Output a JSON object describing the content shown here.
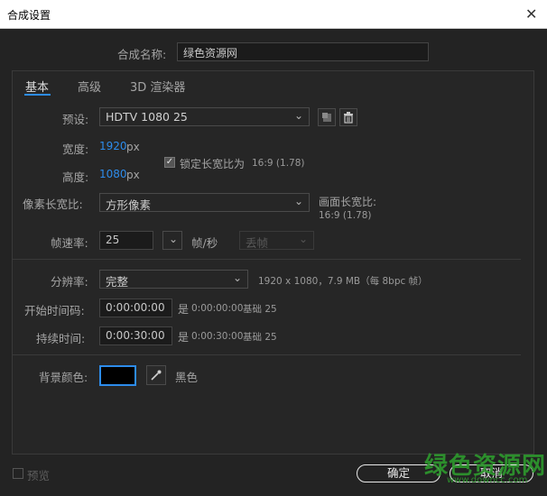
{
  "window": {
    "title": "合成设置",
    "close_glyph": "✕"
  },
  "comp_name": {
    "label": "合成名称:",
    "value": "绿色资源网"
  },
  "tabs": [
    {
      "label": "基本",
      "active": true
    },
    {
      "label": "高级",
      "active": false
    },
    {
      "label": "3D 渲染器",
      "active": false
    }
  ],
  "preset": {
    "label": "预设:",
    "value": "HDTV 1080 25",
    "chevron": "⌄"
  },
  "width": {
    "label": "宽度:",
    "value": "1920",
    "unit": "px"
  },
  "height": {
    "label": "高度:",
    "value": "1080",
    "unit": "px"
  },
  "lock_aspect": {
    "checked": true,
    "check_glyph": "✓",
    "label": "锁定长宽比为",
    "ratio": "16:9 (1.78)"
  },
  "pixel_aspect": {
    "label": "像素长宽比:",
    "value": "方形像素",
    "chevron": "⌄"
  },
  "frame_aspect": {
    "label": "画面长宽比:",
    "value": "16:9 (1.78)"
  },
  "frame_rate": {
    "label": "帧速率:",
    "value": "25",
    "chevron": "⌄",
    "unit": "帧/秒",
    "drop_frame": "丢帧"
  },
  "resolution": {
    "label": "分辨率:",
    "value": "完整",
    "chevron": "⌄",
    "info": "1920 x 1080，7.9 MB（每 8bpc 帧）"
  },
  "start_timecode": {
    "label": "开始时间码:",
    "value": "0:00:00:00",
    "is_label": "是",
    "is_value": "0:00:00:00",
    "base": "基础 25"
  },
  "duration": {
    "label": "持续时间:",
    "value": "0:00:30:00",
    "is_label": "是",
    "is_value": "0:00:30:00",
    "base": "基础 25"
  },
  "background": {
    "label": "背景颜色:",
    "swatch_color": "#000000",
    "color_name": "黑色"
  },
  "footer": {
    "preview_label": "预览",
    "ok_label": "确定",
    "cancel_label": "取消"
  },
  "watermark": {
    "text": "绿色资源网",
    "url": "www.downcc.com"
  },
  "colors": {
    "accent": "#2d8ceb",
    "background": "#232323",
    "watermark": "#2e9a2e"
  }
}
